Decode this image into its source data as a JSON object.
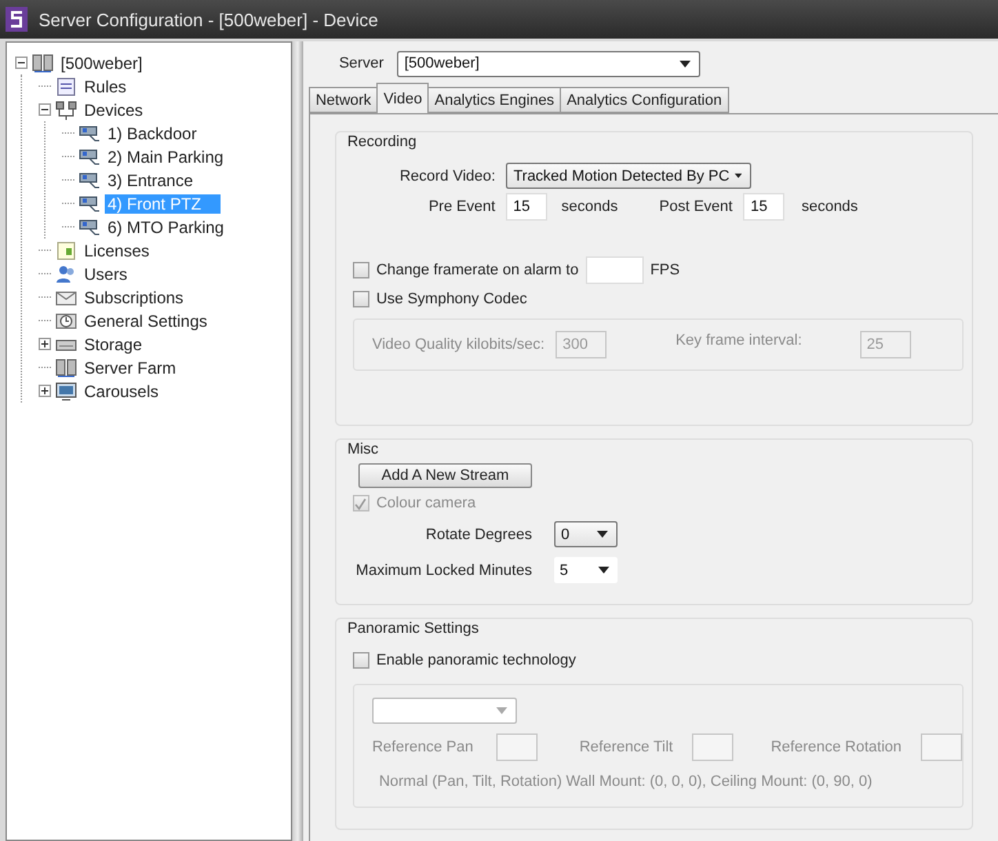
{
  "window": {
    "title": "Server Configuration - [500weber] - Device"
  },
  "tree": [
    {
      "label": "[500weber]",
      "kind": "server",
      "expanded": true,
      "selected": false,
      "children": [
        {
          "label": "Rules",
          "kind": "rules",
          "selected": false
        },
        {
          "label": "Devices",
          "kind": "network",
          "expanded": true,
          "selected": false,
          "children": [
            {
              "label": "1) Backdoor",
              "kind": "camera",
              "selected": false
            },
            {
              "label": "2) Main Parking",
              "kind": "camera",
              "selected": false
            },
            {
              "label": "3) Entrance",
              "kind": "camera",
              "selected": false
            },
            {
              "label": "4) Front PTZ",
              "kind": "camera",
              "selected": true
            },
            {
              "label": "6) MTO Parking",
              "kind": "camera",
              "selected": false
            }
          ]
        },
        {
          "label": "Licenses",
          "kind": "license",
          "selected": false
        },
        {
          "label": "Users",
          "kind": "users",
          "selected": false
        },
        {
          "label": "Subscriptions",
          "kind": "mail",
          "selected": false
        },
        {
          "label": "General Settings",
          "kind": "settings",
          "selected": false
        },
        {
          "label": "Storage",
          "kind": "storage",
          "expanded": false,
          "selected": false
        },
        {
          "label": "Server Farm",
          "kind": "server",
          "selected": false
        },
        {
          "label": "Carousels",
          "kind": "monitor",
          "expanded": false,
          "selected": false
        }
      ]
    }
  ],
  "server": {
    "label": "Server",
    "value": "[500weber]"
  },
  "tabs": [
    {
      "label": "Network",
      "selected": false
    },
    {
      "label": "Video",
      "selected": true
    },
    {
      "label": "Analytics Engines",
      "selected": false
    },
    {
      "label": "Analytics Configuration",
      "selected": false
    }
  ],
  "recording": {
    "title": "Recording",
    "record_video": {
      "label": "Record Video:",
      "value": "Tracked Motion Detected By PC"
    },
    "pre_event": {
      "label": "Pre Event",
      "value": "15",
      "unit": "seconds"
    },
    "post_event": {
      "label": "Post Event",
      "value": "15",
      "unit": "seconds"
    },
    "change_framerate": {
      "label": "Change framerate on alarm to",
      "checked": false,
      "unit": "FPS"
    },
    "symphony_codec": {
      "label": "Use Symphony Codec",
      "checked": false
    },
    "quality": {
      "disabled": true,
      "video_quality": {
        "label": "Video Quality kilobits/sec:",
        "value": "300"
      },
      "key_frame": {
        "label": "Key frame interval:",
        "value": "25"
      }
    }
  },
  "misc": {
    "title": "Misc",
    "add_stream": "Add A New Stream",
    "colour_camera": {
      "label": "Colour camera",
      "checked": true,
      "disabled": true
    },
    "rotate": {
      "label": "Rotate Degrees",
      "value": "0"
    },
    "max_locked": {
      "label": "Maximum Locked Minutes",
      "value": "5"
    }
  },
  "panoramic": {
    "title": "Panoramic Settings",
    "enable": {
      "label": "Enable panoramic technology",
      "checked": false
    },
    "reference": {
      "disabled": true,
      "pan": "Reference Pan",
      "tilt": "Reference Tilt",
      "rotation": "Reference Rotation",
      "note": "Normal (Pan, Tilt, Rotation) Wall Mount: (0, 0, 0), Ceiling Mount: (0, 90, 0)"
    }
  }
}
